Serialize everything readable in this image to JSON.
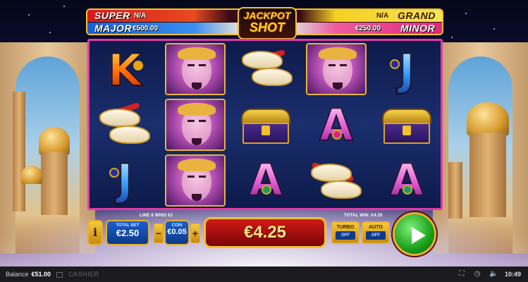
{
  "jackpots": {
    "super": {
      "label": "SUPER",
      "value": "N/A"
    },
    "major": {
      "label": "MAJOR",
      "value": "€500.00"
    },
    "grand": {
      "label": "GRAND",
      "value": "N/A"
    },
    "minor": {
      "label": "MINOR",
      "value": "€250.00"
    },
    "title_line1": "JACKPOT",
    "title_line2": "SHOT"
  },
  "reels": [
    [
      "K",
      "shoes",
      "J"
    ],
    [
      "genie",
      "genie",
      "genie"
    ],
    [
      "shoes",
      "chest",
      "A"
    ],
    [
      "genie",
      "A",
      "shoes"
    ],
    [
      "J",
      "chest",
      "A"
    ]
  ],
  "win_info": {
    "line_wins": "LINE 8 WINS €2",
    "total_win": "TOTAL WIN: €4.25"
  },
  "controls": {
    "info_label": "i",
    "total_bet_label": "TOTAL BET",
    "total_bet_value": "€2.50",
    "coin_label": "COIN",
    "coin_value": "€0.05",
    "minus_label": "−",
    "plus_label": "+",
    "win_value": "€4.25",
    "turbo_label": "TURBO",
    "turbo_state": "OFF",
    "auto_label": "AUTO",
    "auto_state": "OFF"
  },
  "status_bar": {
    "balance_label": "Balance",
    "balance_value": "€51.00",
    "cashier_label": "CASHIER",
    "time": "10:49"
  },
  "colors": {
    "reel_border": "#e23aa8",
    "gold": "#f2c030",
    "spin_green": "#1aa01a"
  }
}
